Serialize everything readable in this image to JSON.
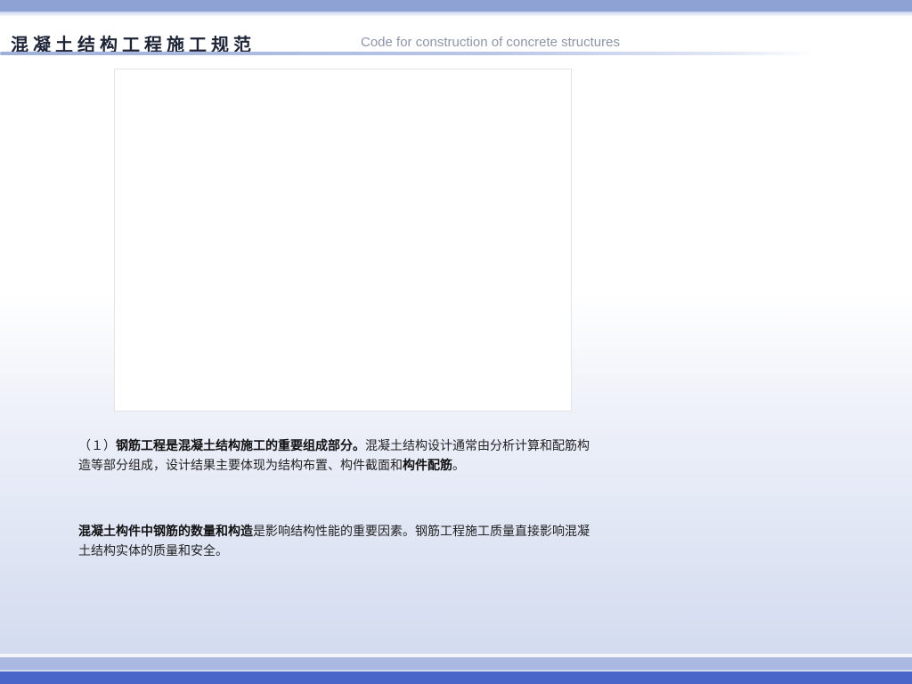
{
  "header": {
    "title_cn": "混凝土结构工程施工规范",
    "title_en": "Code for construction of concrete structures"
  },
  "content": {
    "p1_prefix": "（１）",
    "p1_bold": "钢筋工程是混凝土结构施工的重要组成部分。",
    "p1_text": "混凝土结构设计通常由分析计算和配筋构造等部分组成，设计结果主要体现为结构布置、构件截面和",
    "p1_bold2": "构件配筋",
    "p1_end": "。",
    "p2_bold": "混凝土构件中钢筋的数量和构造",
    "p2_text": "是影响结构性能的重要因素。钢筋工程施工质量直接影响混凝土结构实体的质量和安全。"
  },
  "colors": {
    "top_bar": "#8ea3d3",
    "bottom_bar_dark": "#4a66c8",
    "bottom_bar_light": "#a9b8e0",
    "title_text": "#1e2438",
    "subtitle_text": "#8d95a8"
  }
}
